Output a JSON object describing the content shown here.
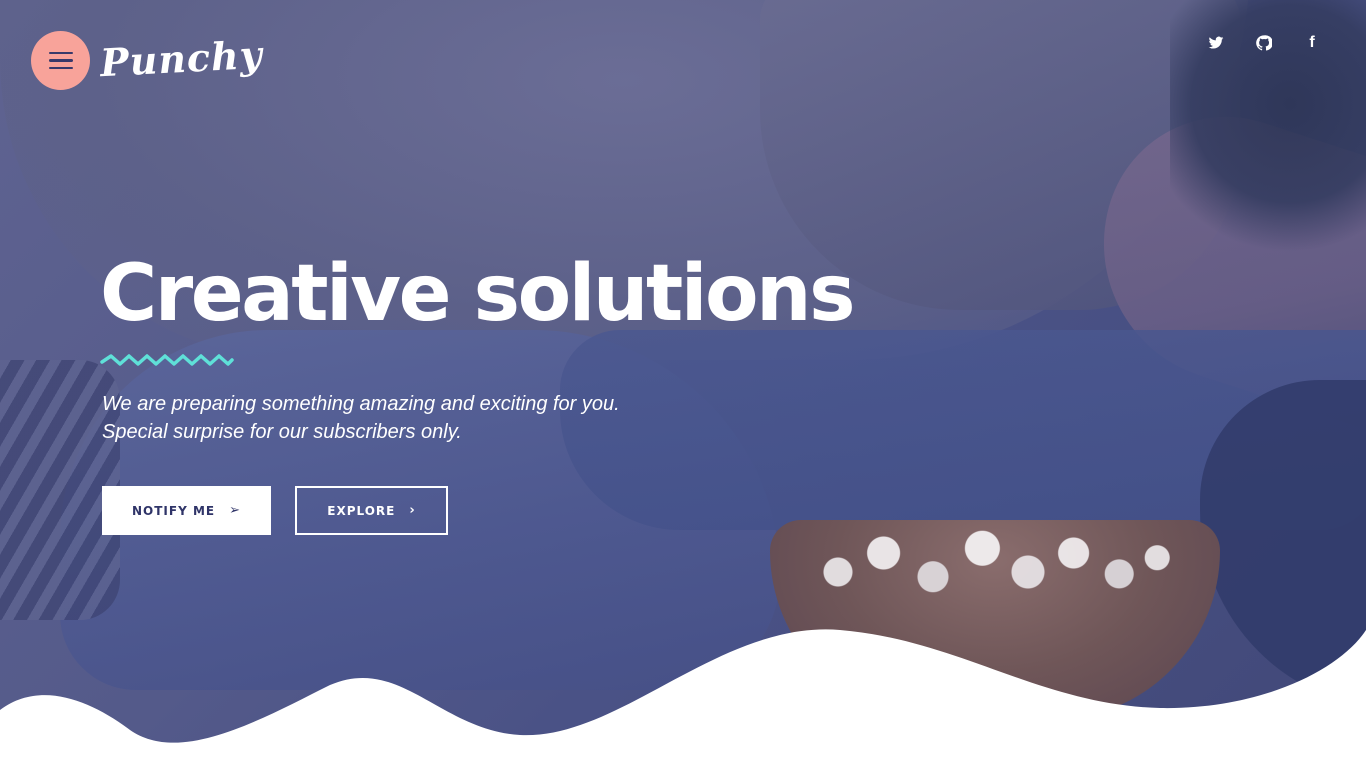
{
  "header": {
    "brand": "Punchy",
    "menu_icon": "hamburger-icon",
    "social": [
      {
        "icon": "twitter-icon"
      },
      {
        "icon": "github-icon"
      },
      {
        "icon": "facebook-icon",
        "glyph": "f"
      }
    ]
  },
  "hero": {
    "title": "Creative solutions",
    "subtitle_line1": "We are preparing something amazing and exciting for you.",
    "subtitle_line2": "Special surprise for our subscribers only.",
    "notify_label": "NOTIFY ME",
    "notify_arrow": "➢",
    "explore_label": "EXPLORE",
    "explore_arrow": "›"
  },
  "colors": {
    "accent_pink": "#f8a39a",
    "zigzag_teal": "#5fe0d8",
    "overlay_navy": "#4a5286",
    "button_text": "#2f3468"
  }
}
